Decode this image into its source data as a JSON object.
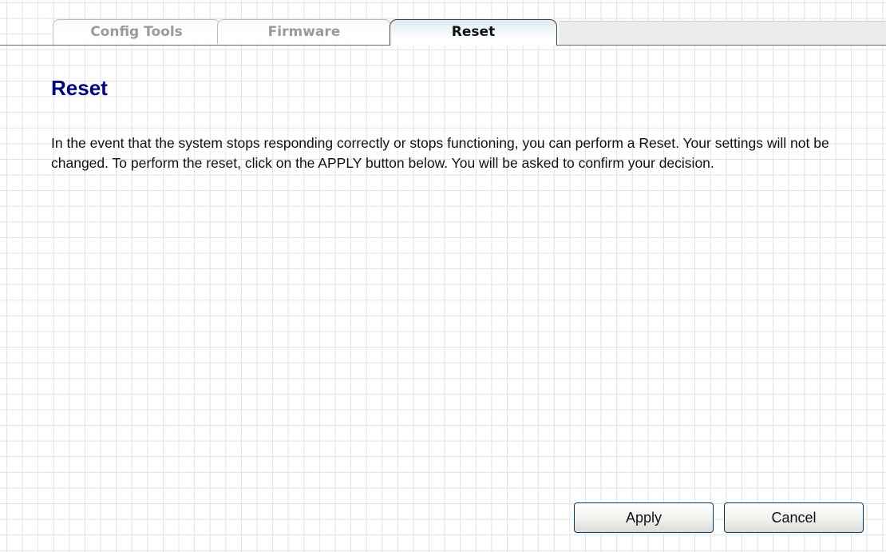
{
  "tabs": [
    {
      "label": "Config Tools",
      "active": false
    },
    {
      "label": "Firmware",
      "active": false
    },
    {
      "label": "Reset",
      "active": true
    }
  ],
  "page": {
    "title": "Reset",
    "description": "In the event that the system stops responding correctly or stops functioning, you can perform a Reset. Your settings will not be changed. To perform the reset, click on the APPLY button below. You will be asked to confirm your decision."
  },
  "buttons": {
    "apply_label": "Apply",
    "cancel_label": "Cancel"
  },
  "colors": {
    "title": "#000080",
    "grid_line": "#e2e2e2",
    "active_tab_gradient_top": "#dcebf3",
    "button_border": "#003c74"
  }
}
